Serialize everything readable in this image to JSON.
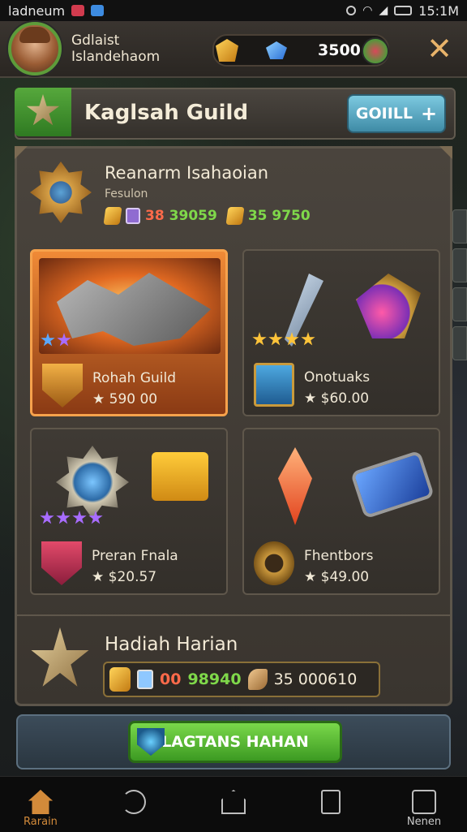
{
  "status_bar": {
    "left_text": "ladneum",
    "time": "15:1M"
  },
  "header": {
    "player_line1": "Gdlaist",
    "player_line2": "Islandehaom",
    "currency_value": "3500",
    "close_label": "✕"
  },
  "guild": {
    "title": "Kaglsah Guild",
    "button_label": "GOIILL",
    "button_icon": "+"
  },
  "featured": {
    "title": "Reanarm Isahaoian",
    "subtitle": "Fesulon",
    "val1": "38",
    "val2": "39059",
    "val3": "35 9750"
  },
  "cards": [
    {
      "name": "Rohah Guild",
      "price": "★ 590 00"
    },
    {
      "name": "Onotuaks",
      "price": "★ $60.00"
    },
    {
      "name": "Preran Fnala",
      "price": "★ $20.57"
    },
    {
      "name": "Fhentbors",
      "price": "★ $49.00"
    }
  ],
  "reward": {
    "title": "Hadiah Harian",
    "val_red": "00",
    "val_green": "98940",
    "val_white": "35 000610"
  },
  "action": {
    "label": "LAGTANS HAHAN"
  },
  "nav": [
    {
      "label": "Rarain",
      "icon": "home-icon"
    },
    {
      "label": "",
      "icon": "back-icon"
    },
    {
      "label": "",
      "icon": "house-icon"
    },
    {
      "label": "",
      "icon": "recents-icon"
    },
    {
      "label": "Nenen",
      "icon": "profile-icon"
    }
  ],
  "colors": {
    "accent_green": "#5ba83a",
    "accent_blue": "#4fa6c8",
    "gold": "#f2b146"
  }
}
